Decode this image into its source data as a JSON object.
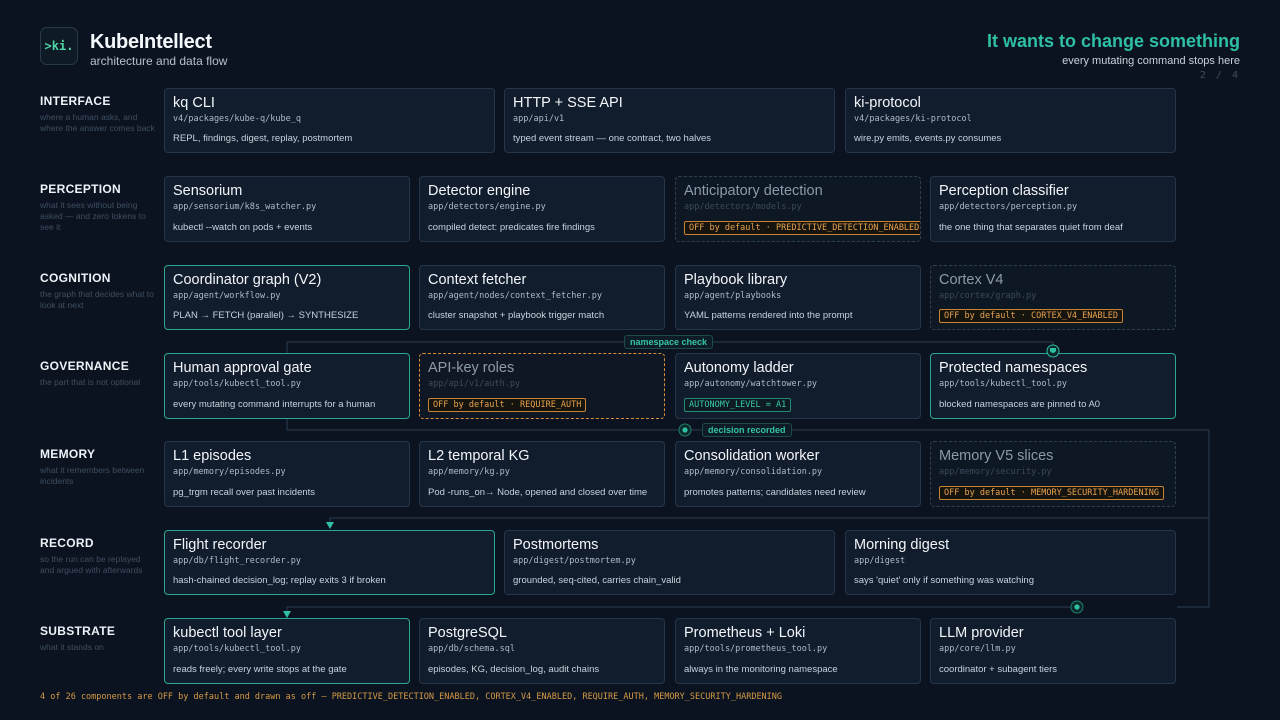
{
  "header": {
    "logo_text": ">ki.",
    "title": "KubeIntellect",
    "subtitle": "architecture and data flow",
    "headline": "It wants to change something",
    "headline_sub": "every mutating command stops here",
    "page": "2 / 4"
  },
  "colors": {
    "background": "#0b1320",
    "accent": "#2ebfa4",
    "off_flag": "#e8a24d"
  },
  "layers": [
    {
      "name": "INTERFACE",
      "desc": "where a human asks, and where the answer comes back",
      "cards": [
        {
          "title": "kq CLI",
          "path": "v4/packages/kube-q/kube_q",
          "desc": "REPL, findings, digest, replay, postmortem"
        },
        {
          "title": "HTTP + SSE API",
          "path": "app/api/v1",
          "desc": "typed event stream — one contract, two halves"
        },
        {
          "title": "ki-protocol",
          "path": "v4/packages/ki-protocol",
          "desc": "wire.py emits, events.py consumes"
        }
      ]
    },
    {
      "name": "PERCEPTION",
      "desc": "what it sees without being asked — and zero tokens to see it",
      "cards": [
        {
          "title": "Sensorium",
          "path": "app/sensorium/k8s_watcher.py",
          "desc": "kubectl --watch on pods + events"
        },
        {
          "title": "Detector engine",
          "path": "app/detectors/engine.py",
          "desc": "compiled detect: predicates fire findings"
        },
        {
          "title": "Anticipatory detection",
          "path": "app/detectors/models.py",
          "flag": "OFF by default · PREDICTIVE_DETECTION_ENABLED"
        },
        {
          "title": "Perception classifier",
          "path": "app/detectors/perception.py",
          "desc": "the one thing that separates quiet from deaf"
        }
      ]
    },
    {
      "name": "COGNITION",
      "desc": "the graph that decides what to look at next",
      "cards": [
        {
          "title": "Coordinator graph (V2)",
          "path": "app/agent/workflow.py",
          "desc": "PLAN → FETCH (parallel) → SYNTHESIZE"
        },
        {
          "title": "Context fetcher",
          "path": "app/agent/nodes/context_fetcher.py",
          "desc": "cluster snapshot + playbook trigger match"
        },
        {
          "title": "Playbook library",
          "path": "app/agent/playbooks",
          "desc": "YAML patterns rendered into the prompt"
        },
        {
          "title": "Cortex V4",
          "path": "app/cortex/graph.py",
          "flag": "OFF by default · CORTEX_V4_ENABLED"
        }
      ]
    },
    {
      "name": "GOVERNANCE",
      "desc": "the part that is not optional",
      "cards": [
        {
          "title": "Human approval gate",
          "path": "app/tools/kubectl_tool.py",
          "desc": "every mutating command interrupts for a human"
        },
        {
          "title": "API-key roles",
          "path": "app/api/v1/auth.py",
          "flag": "OFF by default · REQUIRE_AUTH"
        },
        {
          "title": "Autonomy ladder",
          "path": "app/autonomy/watchtower.py",
          "flag": "AUTONOMY_LEVEL = A1"
        },
        {
          "title": "Protected namespaces",
          "path": "app/tools/kubectl_tool.py",
          "desc": "blocked namespaces are pinned to A0"
        }
      ]
    },
    {
      "name": "MEMORY",
      "desc": "what it remembers between incidents",
      "cards": [
        {
          "title": "L1 episodes",
          "path": "app/memory/episodes.py",
          "desc": "pg_trgm recall over past incidents"
        },
        {
          "title": "L2 temporal KG",
          "path": "app/memory/kg.py",
          "desc": "Pod -runs_on→ Node, opened and closed over time"
        },
        {
          "title": "Consolidation worker",
          "path": "app/memory/consolidation.py",
          "desc": "promotes patterns; candidates need review"
        },
        {
          "title": "Memory V5 slices",
          "path": "app/memory/security.py",
          "flag": "OFF by default · MEMORY_SECURITY_HARDENING"
        }
      ]
    },
    {
      "name": "RECORD",
      "desc": "so the run can be replayed and argued with afterwards",
      "cards": [
        {
          "title": "Flight recorder",
          "path": "app/db/flight_recorder.py",
          "desc": "hash-chained decision_log; replay exits 3 if broken"
        },
        {
          "title": "Postmortems",
          "path": "app/digest/postmortem.py",
          "desc": "grounded, seq-cited, carries chain_valid"
        },
        {
          "title": "Morning digest",
          "path": "app/digest",
          "desc": "says 'quiet' only if something was watching"
        }
      ]
    },
    {
      "name": "SUBSTRATE",
      "desc": "what it stands on",
      "cards": [
        {
          "title": "kubectl tool layer",
          "path": "app/tools/kubectl_tool.py",
          "desc": "reads freely; every write stops at the gate"
        },
        {
          "title": "PostgreSQL",
          "path": "app/db/schema.sql",
          "desc": "episodes, KG, decision_log, audit chains"
        },
        {
          "title": "Prometheus + Loki",
          "path": "app/tools/prometheus_tool.py",
          "desc": "always in the monitoring namespace"
        },
        {
          "title": "LLM provider",
          "path": "app/core/llm.py",
          "desc": "coordinator + subagent tiers"
        }
      ]
    }
  ],
  "wire_labels": {
    "namespace_check": "namespace check",
    "decision_recorded": "decision recorded"
  },
  "footnote": "4 of 26 components are OFF by default and drawn as off — PREDICTIVE_DETECTION_ENABLED, CORTEX_V4_ENABLED, REQUIRE_AUTH, MEMORY_SECURITY_HARDENING"
}
